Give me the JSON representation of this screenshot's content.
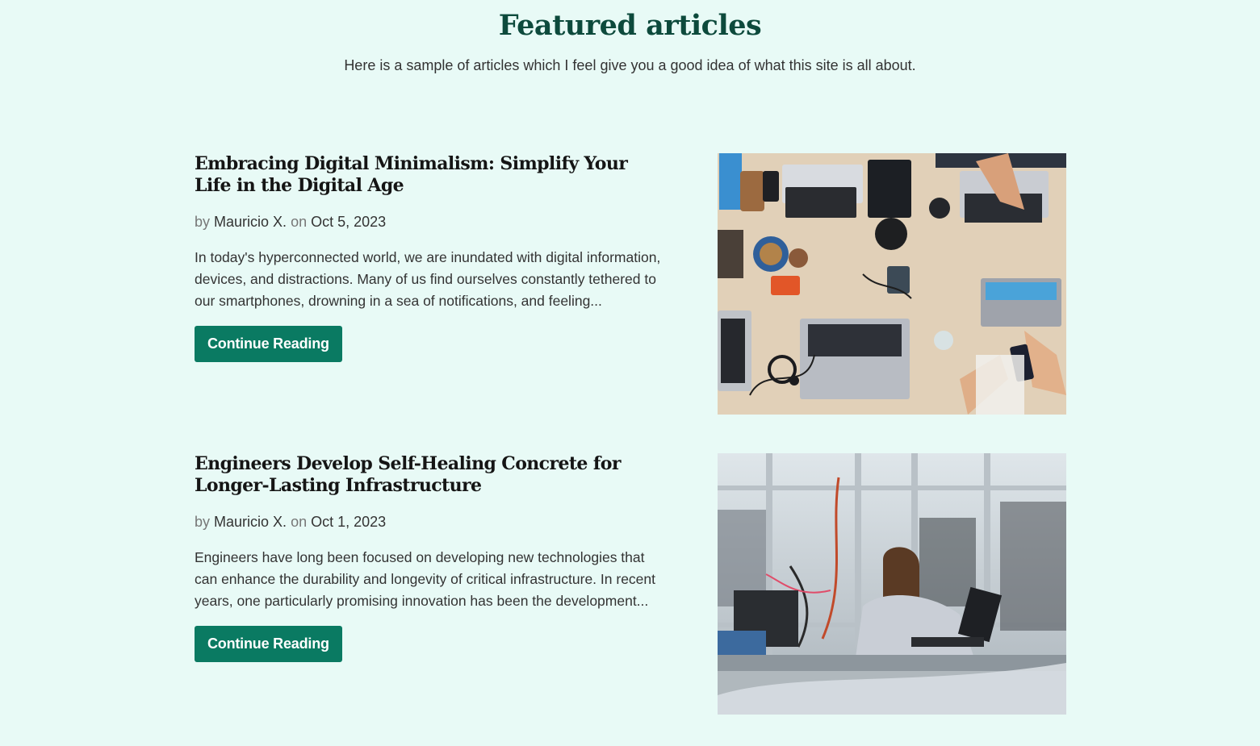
{
  "section": {
    "title": "Featured articles",
    "intro": "Here is a sample of articles which I feel give you a good idea of what this site is all about."
  },
  "articles": [
    {
      "title": "Embracing Digital Minimalism: Simplify Your Life in the Digital Age",
      "by_label": "by",
      "author": "Mauricio X.",
      "on_label": "on",
      "date": "Oct 5, 2023",
      "excerpt": "In today's hyperconnected world, we are inundated with digital information, devices, and distractions. Many of us find ourselves constantly tethered to our smartphones, drowning in a sea of notifications, and feeling...",
      "button_label": "Continue Reading",
      "image_subject": "overhead-desk-with-laptops"
    },
    {
      "title": "Engineers Develop Self-Healing Concrete for Longer-Lasting Infrastructure",
      "by_label": "by",
      "author": "Mauricio X.",
      "on_label": "on",
      "date": "Oct 1, 2023",
      "excerpt": "Engineers have long been focused on developing new technologies that can enhance the durability and longevity of critical infrastructure. In recent years, one particularly promising innovation has been the development...",
      "button_label": "Continue Reading",
      "image_subject": "engineer-working-in-lab"
    }
  ],
  "colors": {
    "background": "#e8faf6",
    "heading": "#0d4a3c",
    "button": "#0a7a62",
    "button_text": "#ffffff"
  }
}
